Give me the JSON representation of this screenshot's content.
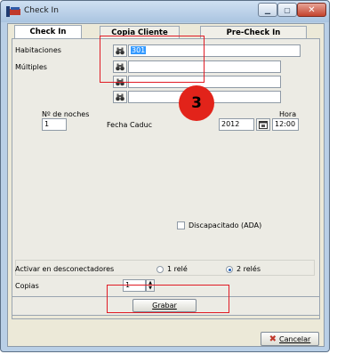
{
  "window": {
    "title": "Check In"
  },
  "tabs": [
    "Check In",
    "Copia Cliente",
    "Pre-Check In"
  ],
  "form": {
    "habitaciones_label": "Habitaciones",
    "habitaciones_value": "301",
    "multiples_label": "Múltiples",
    "noches_label": "Nº de noches",
    "noches_value": "1",
    "fecha_label": "Fecha Caduc",
    "fecha_value": "2012",
    "hora_label": "Hora",
    "hora_value": "12:00",
    "discapacitado_label": "Discapacitado (ADA)",
    "activar_label": "Activar en desconectadores",
    "rele1_label": "1 relé",
    "rele2_label": "2 relés",
    "copias_label": "Copias",
    "copias_value": "1"
  },
  "buttons": {
    "grabar": "Grabar",
    "cancelar": "Cancelar"
  },
  "annotation": {
    "step_number": "3",
    "color": "#e01b24"
  }
}
